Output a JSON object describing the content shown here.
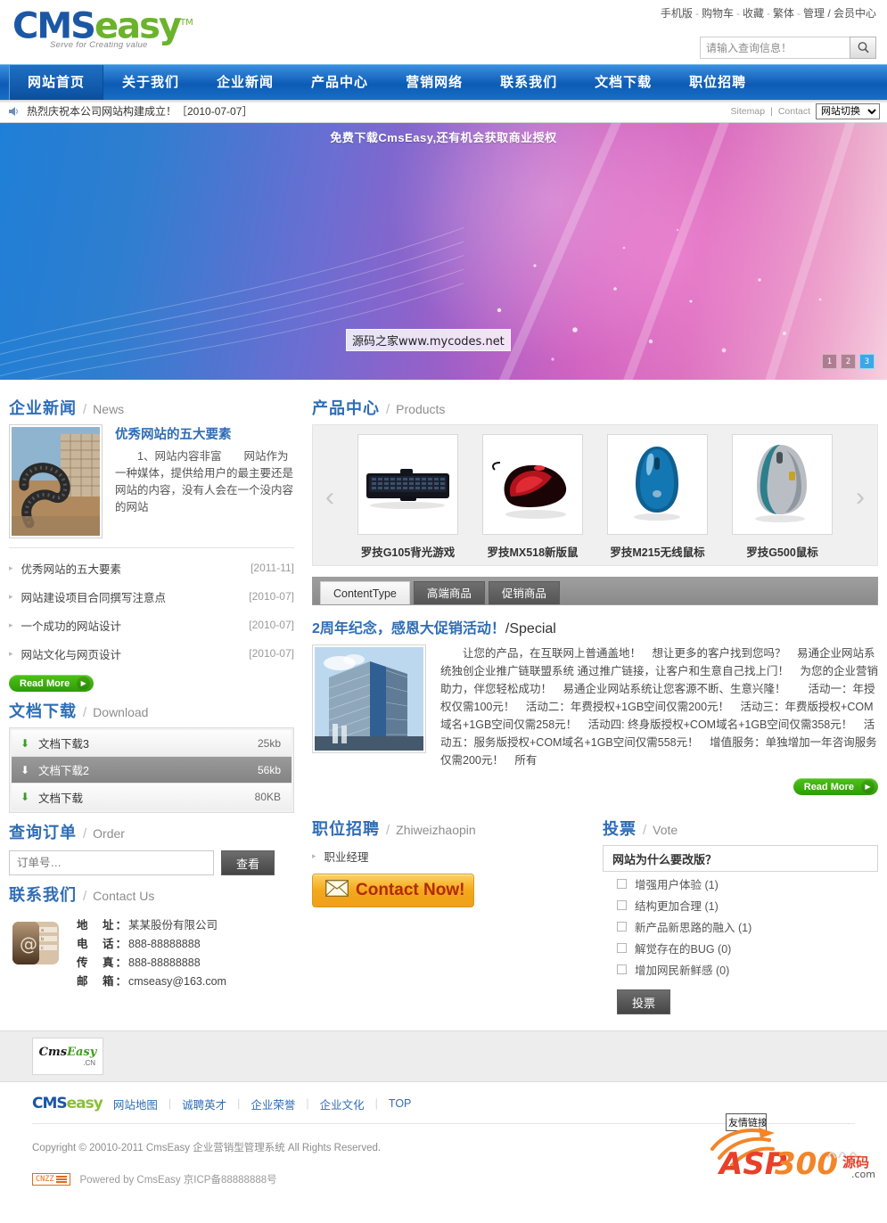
{
  "header": {
    "logo": {
      "part1": "CMS",
      "part2": "easy",
      "tm": "TM",
      "slogan": "Serve for Creating value"
    },
    "toplinks": [
      {
        "label": "手机版"
      },
      {
        "label": "购物车"
      },
      {
        "label": "收藏"
      },
      {
        "label": "繁体"
      },
      {
        "label": "管理 / 会员中心"
      }
    ],
    "separator": "-",
    "search": {
      "placeholder": "请输入查询信息！",
      "value": "",
      "icon": "search-icon"
    }
  },
  "nav": {
    "items": [
      {
        "label": "网站首页",
        "active": true
      },
      {
        "label": "关于我们",
        "active": false
      },
      {
        "label": "企业新闻",
        "active": false
      },
      {
        "label": "产品中心",
        "active": false
      },
      {
        "label": "营销网络",
        "active": false
      },
      {
        "label": "联系我们",
        "active": false
      },
      {
        "label": "文档下载",
        "active": false
      },
      {
        "label": "职位招聘",
        "active": false
      }
    ]
  },
  "notice": {
    "icon": "speaker-icon",
    "text": "热烈庆祝本公司网站构建成立！［2010-07-07］",
    "sitemap": "Sitemap",
    "divider": "|",
    "contact": "Contact",
    "site_switch": "网站切换"
  },
  "banner": {
    "top_text": "免费下载CmsEasy,还有机会获取商业授权",
    "watermark": "源码之家www.mycodes.net",
    "dots": [
      "1",
      "2",
      "3"
    ],
    "active_dot": 3
  },
  "news": {
    "title_cn": "企业新闻",
    "title_en": "News",
    "slash": "/",
    "feature": {
      "headline": "优秀网站的五大要素",
      "summary": "1、网站内容非富　　网站作为一种媒体，提供给用户的最主要还是网站的内容，没有人会在一个没内容的网站"
    },
    "items": [
      {
        "title": "优秀网站的五大要素",
        "date": "[2011-11]"
      },
      {
        "title": "网站建设项目合同撰写注意点",
        "date": "[2010-07]"
      },
      {
        "title": "一个成功的网站设计",
        "date": "[2010-07]"
      },
      {
        "title": "网站文化与网页设计",
        "date": "[2010-07]"
      }
    ],
    "read_more": "Read More"
  },
  "download": {
    "title_cn": "文档下载",
    "title_en": "Download",
    "slash": "/",
    "items": [
      {
        "name": "文档下载3",
        "size": "25kb",
        "selected": false
      },
      {
        "name": "文档下载2",
        "size": "56kb",
        "selected": true
      },
      {
        "name": "文档下载",
        "size": "80KB",
        "selected": false
      }
    ]
  },
  "order": {
    "title_cn": "查询订单",
    "title_en": "Order",
    "slash": "/",
    "placeholder": "订单号…",
    "value": "",
    "button": "查看"
  },
  "contact": {
    "title_cn": "联系我们",
    "title_en": "Contact Us",
    "slash": "/",
    "icon": "address-book-icon",
    "rows": [
      {
        "label": "地　址：",
        "value": "某某股份有限公司"
      },
      {
        "label": "电　话：",
        "value": "888-88888888"
      },
      {
        "label": "传　真：",
        "value": "888-88888888"
      },
      {
        "label": "邮　箱：",
        "value": "cmseasy@163.com"
      }
    ]
  },
  "products": {
    "title_cn": "产品中心",
    "title_en": "Products",
    "slash": "/",
    "prev_icon": "chevron-left-icon",
    "next_icon": "chevron-right-icon",
    "items": [
      {
        "name": "罗技G105背光游戏",
        "image": "keyboard"
      },
      {
        "name": "罗技MX518新版鼠",
        "image": "red-mouse"
      },
      {
        "name": "罗技M215无线鼠标",
        "image": "blue-mouse"
      },
      {
        "name": "罗技G500鼠标",
        "image": "silver-mouse"
      }
    ],
    "tabs": [
      {
        "label": "ContentType",
        "active": true
      },
      {
        "label": "高端商品",
        "active": false
      },
      {
        "label": "促销商品",
        "active": false
      }
    ]
  },
  "special": {
    "title_cn": "2周年纪念，感恩大促销活动！",
    "title_en": "Special",
    "slash": "/",
    "body": "让您的产品，在互联网上普通盖地！　想让更多的客户找到您吗？　易通企业网站系统独创企业推广链联盟系统 通过推广链接，让客户和生意自己找上门！　为您的企业营销助力，伴您轻松成功！　易通企业网站系统让您客源不断、生意兴隆！　　活动一：年授权仅需100元！　活动二：年费授权+1GB空间仅需200元！　活动三：年费版授权+COM域名+1GB空间仅需258元！　活动四: 终身版授权+COM域名+1GB空间仅需358元！　活动五：服务版授权+COM域名+1GB空间仅需558元！　增值服务：单独增加一年咨询服务仅需200元！　所有",
    "read_more": "Read More"
  },
  "jobs": {
    "title_cn": "职位招聘",
    "title_en": "Zhiweizhaopin",
    "slash": "/",
    "items": [
      {
        "title": "职业经理"
      }
    ],
    "contact_now": "Contact Now!",
    "contact_icon": "envelope-icon"
  },
  "vote": {
    "title_cn": "投票",
    "title_en": "Vote",
    "slash": "/",
    "question": "网站为什么要改版？",
    "options": [
      {
        "label": "增强用户体验 (1)",
        "checked": false
      },
      {
        "label": "结构更加合理 (1)",
        "checked": false
      },
      {
        "label": "新产品新思路的融入 (1)",
        "checked": false
      },
      {
        "label": "解觉存在的BUG (0)",
        "checked": false
      },
      {
        "label": "增加网民新鲜感 (0)",
        "checked": false
      }
    ],
    "button": "投票"
  },
  "footer": {
    "friend_logo": {
      "part1": "Cms",
      "part2": "Easy",
      "cn": ".CN"
    },
    "logo": {
      "part1": "CMS",
      "part2": "easy"
    },
    "links": [
      {
        "label": "网站地图"
      },
      {
        "label": "诚聘英才"
      },
      {
        "label": "企业荣誉"
      },
      {
        "label": "企业文化"
      },
      {
        "label": "TOP"
      }
    ],
    "divider": "|",
    "copyright": "Copyright © 20010-2011 CmsEasy 企业营销型管理系统 All Rights Reserved.",
    "powered": "Powered by CmsEasy  京ICP备88888888号",
    "cnzz": "CNZZ",
    "friend_link_label": "友情链接",
    "watermark": {
      "part1": "ASP",
      "part2": "300",
      "part3": "源码",
      "part4": ".com"
    }
  },
  "colors": {
    "brand_blue": "#2f6db5",
    "nav_blue": "#0d5bb5",
    "green": "#2e9c06",
    "orange": "#f3a81c"
  }
}
